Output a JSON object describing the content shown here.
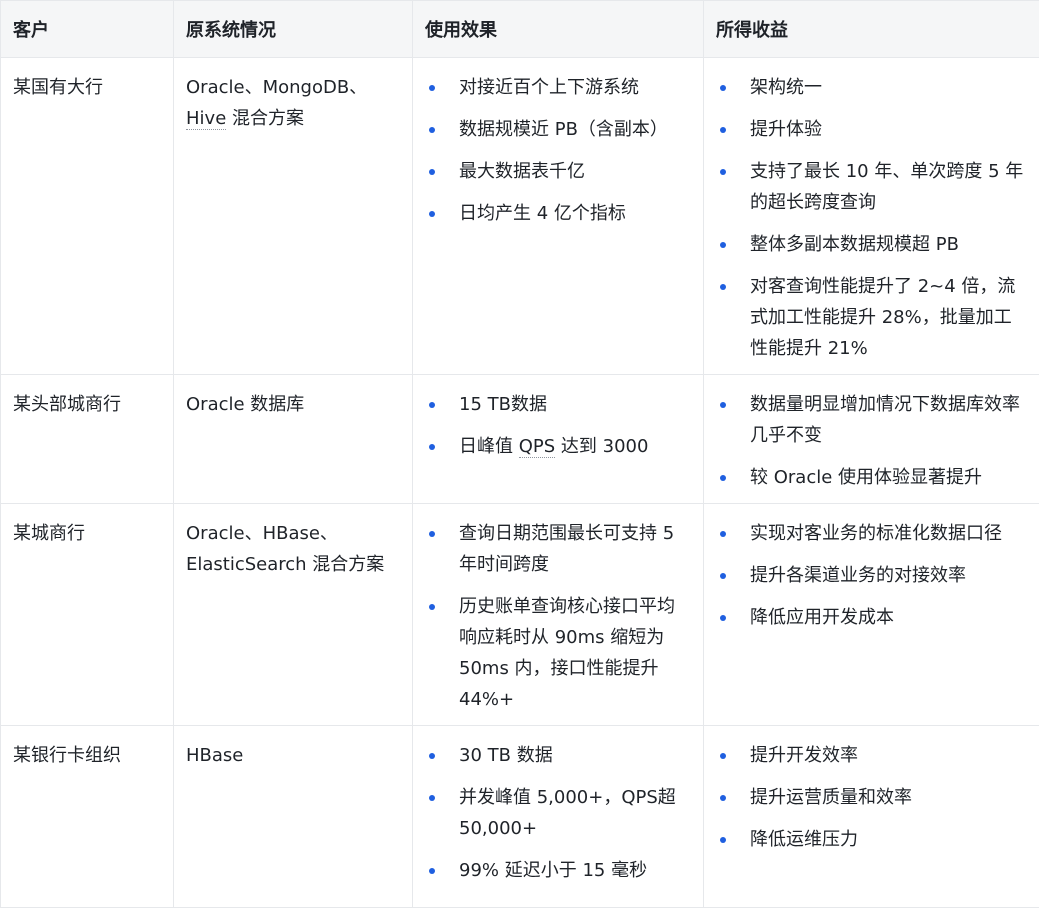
{
  "colors": {
    "header_bg": "#f5f6f7",
    "border": "#e6e8eb",
    "bullet": "#1f5fe0",
    "text": "#1f2329"
  },
  "headers": {
    "customer": "客户",
    "original": "原系统情况",
    "effect": "使用效果",
    "benefit": "所得收益"
  },
  "rows": [
    {
      "customer": "某国有大行",
      "original_parts": [
        "Oracle、MongoDB、",
        "Hive",
        " 混合方案"
      ],
      "effects": [
        "对接近百个上下游系统",
        "数据规模近 PB（含副本）",
        "最大数据表千亿",
        "日均产生 4 亿个指标"
      ],
      "benefits": [
        "架构统一",
        "提升体验",
        "支持了最长 10 年、单次跨度 5 年的超长跨度查询",
        "整体多副本数据规模超 PB",
        "对客查询性能提升了 2~4 倍，流式加工性能提升 28%，批量加工性能提升 21%"
      ]
    },
    {
      "customer": "某头部城商行",
      "original": "Oracle 数据库",
      "effects": [
        "15 TB数据"
      ],
      "effect2_parts": [
        "日峰值 ",
        "QPS",
        " 达到 3000"
      ],
      "benefits": [
        "数据量明显增加情况下数据库效率几乎不变",
        "较 Oracle 使用体验显著提升"
      ]
    },
    {
      "customer": "某城商行",
      "original": "Oracle、HBase、ElasticSearch 混合方案",
      "effects": [
        "查询日期范围最长可支持 5 年时间跨度",
        "历史账单查询核心接口平均响应耗时从 90ms 缩短为 50ms 内，接口性能提升 44%+"
      ],
      "benefits": [
        "实现对客业务的标准化数据口径",
        "提升各渠道业务的对接效率",
        "降低应用开发成本"
      ]
    },
    {
      "customer": "某银行卡组织",
      "original": "HBase",
      "effects": [
        "30 TB 数据",
        "并发峰值 5,000+，QPS超 50,000+",
        "99% 延迟小于 15 毫秒"
      ],
      "benefits": [
        "提升开发效率",
        "提升运营质量和效率",
        "降低运维压力"
      ]
    }
  ]
}
